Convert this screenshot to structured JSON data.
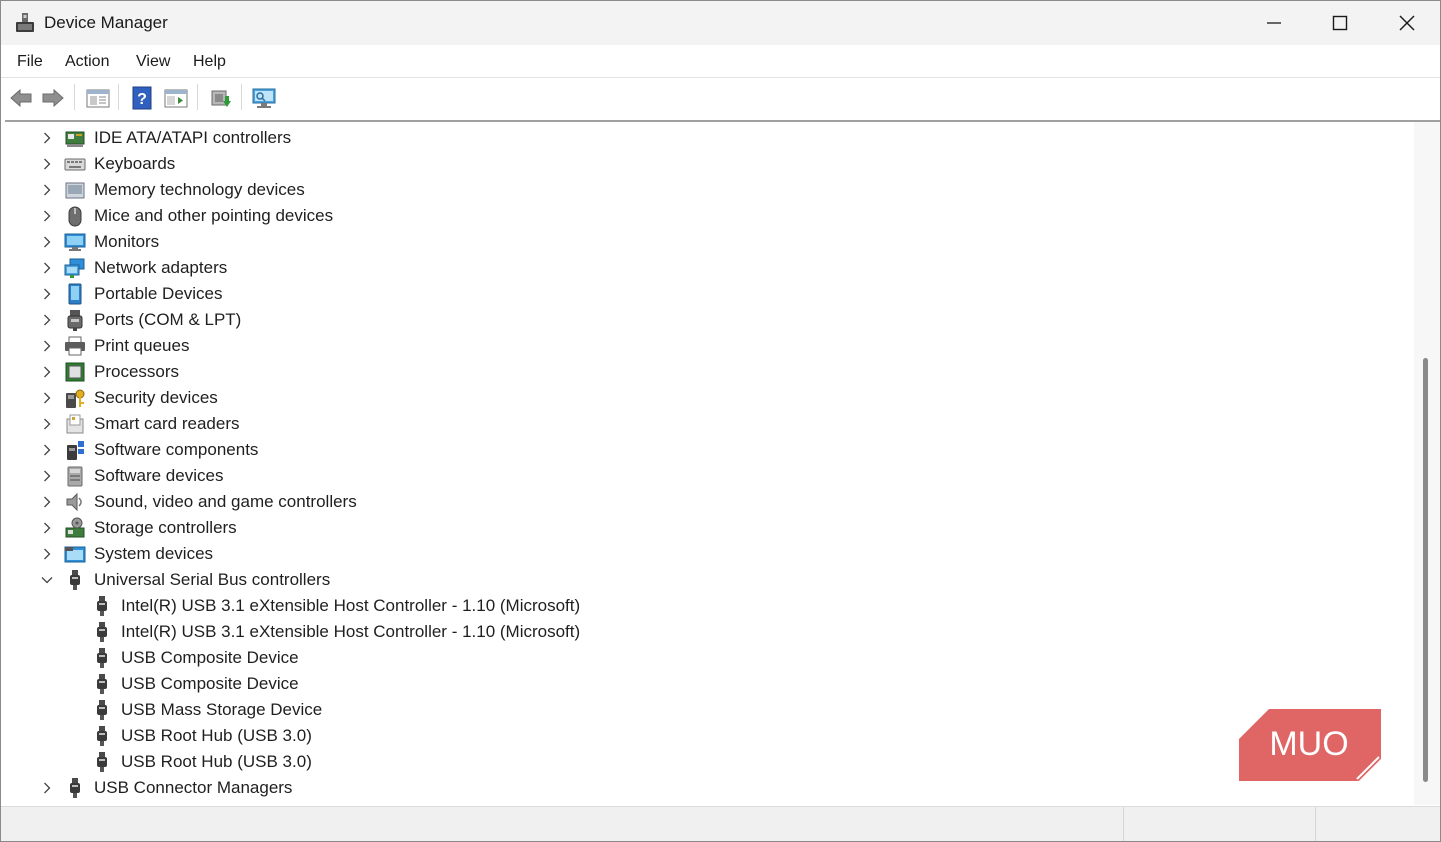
{
  "window": {
    "title": "Device Manager"
  },
  "menu": [
    "File",
    "Action",
    "View",
    "Help"
  ],
  "toolbar": {
    "buttons": [
      "back-icon",
      "forward-icon",
      "properties-pane-icon",
      "help-icon",
      "show-hide-tree-icon",
      "update-driver-icon",
      "scan-hardware-icon"
    ]
  },
  "tree": [
    {
      "label": "IDE ATA/ATAPI controllers",
      "icon": "ide-controller-icon",
      "expanded": false
    },
    {
      "label": "Keyboards",
      "icon": "keyboard-icon",
      "expanded": false
    },
    {
      "label": "Memory technology devices",
      "icon": "memory-device-icon",
      "expanded": false
    },
    {
      "label": "Mice and other pointing devices",
      "icon": "mouse-icon",
      "expanded": false
    },
    {
      "label": "Monitors",
      "icon": "monitor-icon",
      "expanded": false
    },
    {
      "label": "Network adapters",
      "icon": "network-adapter-icon",
      "expanded": false
    },
    {
      "label": "Portable Devices",
      "icon": "portable-device-icon",
      "expanded": false
    },
    {
      "label": "Ports (COM & LPT)",
      "icon": "port-icon",
      "expanded": false
    },
    {
      "label": "Print queues",
      "icon": "printer-icon",
      "expanded": false
    },
    {
      "label": "Processors",
      "icon": "processor-icon",
      "expanded": false
    },
    {
      "label": "Security devices",
      "icon": "security-device-icon",
      "expanded": false
    },
    {
      "label": "Smart card readers",
      "icon": "smart-card-reader-icon",
      "expanded": false
    },
    {
      "label": "Software components",
      "icon": "software-component-icon",
      "expanded": false
    },
    {
      "label": "Software devices",
      "icon": "software-device-icon",
      "expanded": false
    },
    {
      "label": "Sound, video and game controllers",
      "icon": "speaker-icon",
      "expanded": false
    },
    {
      "label": "Storage controllers",
      "icon": "storage-controller-icon",
      "expanded": false
    },
    {
      "label": "System devices",
      "icon": "system-device-icon",
      "expanded": false
    },
    {
      "label": "Universal Serial Bus controllers",
      "icon": "usb-icon",
      "expanded": true,
      "children": [
        "Intel(R) USB 3.1 eXtensible Host Controller - 1.10 (Microsoft)",
        "Intel(R) USB 3.1 eXtensible Host Controller - 1.10 (Microsoft)",
        "USB Composite Device",
        "USB Composite Device",
        "USB Mass Storage Device",
        "USB Root Hub (USB 3.0)",
        "USB Root Hub (USB 3.0)"
      ]
    },
    {
      "label": "USB Connector Managers",
      "icon": "usb-icon",
      "expanded": false
    }
  ],
  "watermark": {
    "text": "MUO",
    "color": "#e06666"
  },
  "colors": {
    "accent": "#1e6fd9",
    "titlebar": "#f3f3f3",
    "statusbar": "#f0f0f0"
  }
}
